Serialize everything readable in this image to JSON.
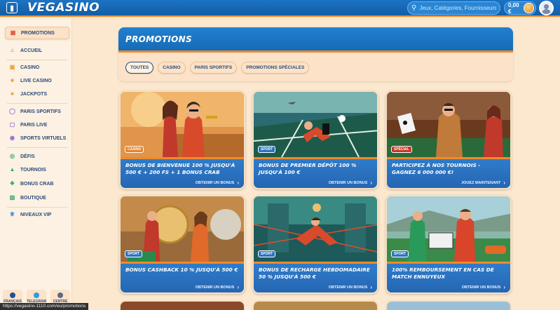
{
  "header": {
    "logo": "VEGASINO",
    "search_placeholder": "Jeux, Catégories, Fournisseurs",
    "balance": "0,00 €"
  },
  "sidebar": {
    "items": [
      {
        "label": "PROMOTIONS",
        "icon": "gift-icon"
      },
      {
        "label": "ACCUEIL",
        "icon": "home-icon"
      },
      {
        "label": "CASINO",
        "icon": "cards-icon"
      },
      {
        "label": "LIVE CASINO",
        "icon": "live-dealer-icon"
      },
      {
        "label": "JACKPOTS",
        "icon": "clover-icon"
      },
      {
        "label": "PARIS SPORTIFS",
        "icon": "ball-icon"
      },
      {
        "label": "PARIS LIVE",
        "icon": "live-icon"
      },
      {
        "label": "SPORTS VIRTUELS",
        "icon": "virtual-sport-icon"
      },
      {
        "label": "DÉFIS",
        "icon": "target-icon"
      },
      {
        "label": "TOURNOIS",
        "icon": "trophy-icon"
      },
      {
        "label": "BONUS CRAB",
        "icon": "crab-icon"
      },
      {
        "label": "BOUTIQUE",
        "icon": "shop-icon"
      },
      {
        "label": "NIVEAUX VIP",
        "icon": "crown-icon"
      }
    ],
    "footer": {
      "language": "FRANÇAIS",
      "telegram": "TELEGRAM",
      "help": "CENTRE"
    }
  },
  "status_url": "https://vegasino-1110.com/eu/promotions",
  "page": {
    "title": "PROMOTIONS",
    "tabs": [
      "TOUTES",
      "CASINO",
      "PARIS SPORTIFS",
      "PROMOTIONS SPÉCIALES"
    ],
    "active_tab": "TOUTES"
  },
  "cards": [
    {
      "badge": "CASINO",
      "title": "BONUS DE BIENVENUE 100 % JUSQU'À 500 € + 200 FS + 1 BONUS CRAB",
      "cta": "OBTENIR UN BONUS"
    },
    {
      "badge": "SPORT",
      "title": "BONUS DE PREMIER DÉPÔT 100 % JUSQU'À 100 €",
      "cta": "OBTENIR UN BONUS"
    },
    {
      "badge": "SPÉCIAL",
      "title": "PARTICIPEZ À NOS TOURNOIS - GAGNEZ 6 000 000 €!",
      "cta": "JOUEZ MAINTENANT"
    },
    {
      "badge": "SPORT",
      "title": "BONUS CASHBACK 10 % JUSQU'À 500 €",
      "cta": "OBTENIR UN BONUS"
    },
    {
      "badge": "SPORT",
      "title": "BONUS DE RECHARGE HEBDOMADAIRE 50 % JUSQU'À 500 €",
      "cta": "OBTENIR UN BONUS"
    },
    {
      "badge": "SPORT",
      "title": "100% REMBOURSEMENT EN CAS DE MATCH ENNUYEUX",
      "cta": "OBTENIR UN BONUS"
    }
  ],
  "colors": {
    "brand_blue": "#1b74c4",
    "accent_orange": "#f08a2a",
    "page_bg": "#fbe8cf"
  }
}
